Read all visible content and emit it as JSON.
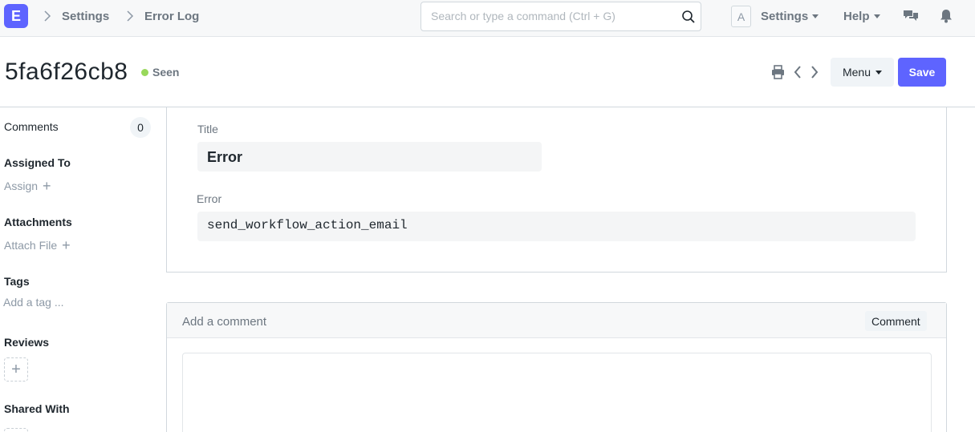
{
  "navbar": {
    "logo_letter": "E",
    "breadcrumbs": [
      "Settings",
      "Error Log"
    ],
    "search_placeholder": "Search or type a command (Ctrl + G)",
    "avatar_letter": "A",
    "settings_label": "Settings",
    "help_label": "Help"
  },
  "page": {
    "title": "5fa6f26cb8",
    "status": "Seen",
    "status_color": "#98d85b",
    "menu_label": "Menu",
    "save_label": "Save",
    "accent": "#5e64ff"
  },
  "sidebar": {
    "comments_label": "Comments",
    "comments_count": "0",
    "assigned_label": "Assigned To",
    "assign_link": "Assign",
    "attachments_label": "Attachments",
    "attach_link": "Attach File",
    "tags_label": "Tags",
    "tag_placeholder": "Add a tag ...",
    "reviews_label": "Reviews",
    "shared_label": "Shared With"
  },
  "form": {
    "title_label": "Title",
    "title_value": "Error",
    "error_label": "Error",
    "error_value": "send_workflow_action_email"
  },
  "comment": {
    "header_label": "Add a comment",
    "button_label": "Comment"
  }
}
